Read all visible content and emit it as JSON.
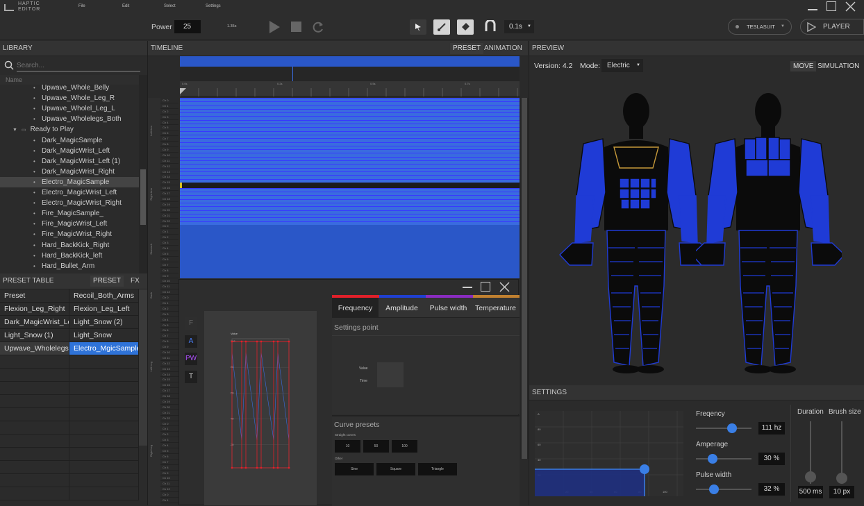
{
  "app": {
    "title_line1": "HAPTIC",
    "title_line2": "EDITOR"
  },
  "menu": [
    "File",
    "Edit",
    "Select",
    "Settings"
  ],
  "toolbar": {
    "power_label": "Power",
    "power_value": "25",
    "time": "1.35s",
    "interval": "0.1s",
    "device": "TESLASUIT",
    "player": "PLAYER"
  },
  "library": {
    "title": "LIBRARY",
    "search_placeholder": "Search...",
    "col_name": "Name",
    "items": [
      "Upwave_Whole_Belly",
      "Upwave_Whole_Leg_R",
      "Upwave_Wholel_Leg_L",
      "Upwave_Wholelegs_Both"
    ],
    "folder": "Ready to Play",
    "folder_items": [
      "Dark_MagicSample",
      "Dark_MagicWrist_Left",
      "Dark_MagicWrist_Left (1)",
      "Dark_MagicWrist_Right",
      "Electro_MagicSample",
      "Electro_MagicWrist_Left",
      "Electro_MagicWrist_Right",
      "Fire_MagicSample_",
      "Fire_MagicWrist_Left",
      "Fire_MagicWrist_Right",
      "Hard_BackKick_Right",
      "Hard_BackKick_left",
      "Hard_Bullet_Arm"
    ]
  },
  "preset_table": {
    "title": "PRESET TABLE",
    "tab_preset": "PRESET",
    "tab_fx": "FX",
    "rows": [
      [
        "Preset",
        "Recoil_Both_Arms"
      ],
      [
        "Flexion_Leg_Right",
        "Flexion_Leg_Left"
      ],
      [
        "Dark_MagicWrist_Left",
        "Light_Snow (2)"
      ],
      [
        "Light_Snow (1)",
        "Light_Snow"
      ],
      [
        "Upwave_Wholelegs...",
        "Electro_MgicSample"
      ]
    ]
  },
  "timeline": {
    "title": "TIMELINE",
    "tab_preset": "PRESET",
    "tab_animation": "ANIMATION",
    "ruler": [
      "0.0s",
      "0.2s",
      "0.5s",
      "0.7s"
    ],
    "channels": [
      "Ch 0",
      "Ch 1",
      "Ch 2",
      "Ch 3",
      "Ch 4",
      "Ch 5",
      "Ch 6",
      "Ch 7",
      "Ch 8",
      "Ch 9",
      "Ch 10",
      "Ch 11",
      "Ch 12",
      "Ch 13",
      "Ch 14",
      "Ch 15",
      "Ch 16",
      "Ch 17",
      "Ch 18",
      "Ch 19",
      "Ch 20",
      "Ch 21",
      "Ch 22",
      "Ch 0",
      "Ch 1",
      "Ch 2",
      "Ch 3",
      "Ch 4",
      "Ch 5",
      "Ch 6",
      "Ch 7",
      "Ch 8",
      "Ch 9",
      "Ch 10",
      "Ch 11",
      "Ch 12"
    ],
    "groups": [
      "Left Arm",
      "Right Arm",
      "Stomach",
      "Back",
      "Left Leg",
      "Right Leg"
    ]
  },
  "curve_editor": {
    "side_buttons": [
      "F",
      "A",
      "PW",
      "T"
    ],
    "y_label": "Value",
    "y_ticks": [
      "100",
      "80",
      "60",
      "40",
      "20"
    ],
    "tabs": [
      "Frequency",
      "Amplitude",
      "Pulse width",
      "Temperature"
    ],
    "tab_colors": [
      "#e0202a",
      "#2040d0",
      "#8a2cc0",
      "#c08030"
    ],
    "settings_point": "Settings point",
    "value_label": "Value",
    "time_label": "Time",
    "curve_presets": "Curve presets",
    "straight_curves": "Straight curves",
    "straight": [
      "10",
      "50",
      "100"
    ],
    "other": "Other",
    "other_buttons": [
      "Sine",
      "Square",
      "Triangle"
    ]
  },
  "preview": {
    "title": "PREVIEW",
    "version": "Version: 4.2",
    "mode_label": "Mode:",
    "mode_value": "Electric",
    "move": "MOVE",
    "simulation": "SIMULATION"
  },
  "settings": {
    "title": "SETTINGS",
    "frequency_label": "Freqency",
    "frequency_value": "111 hz",
    "frequency_level": 0.65,
    "amperage_label": "Amperage",
    "amperage_value": "30 %",
    "amperage_level": 0.3,
    "pulse_label": "Pulse width",
    "pulse_value": "32 %",
    "pulse_level": 0.32,
    "duration_label": "Duration",
    "duration_value": "500 ms",
    "brush_label": "Brush size",
    "brush_value": "10 px",
    "graph_y": [
      "A",
      "80",
      "60",
      "40",
      "20"
    ],
    "graph_x": [
      "20",
      "40",
      "60",
      "80",
      "100",
      "120"
    ]
  },
  "colors": {
    "accent": "#3a7fe6",
    "track": "#3a6bdf",
    "curve": "#e0202a",
    "suit": "#1f3bd6"
  }
}
